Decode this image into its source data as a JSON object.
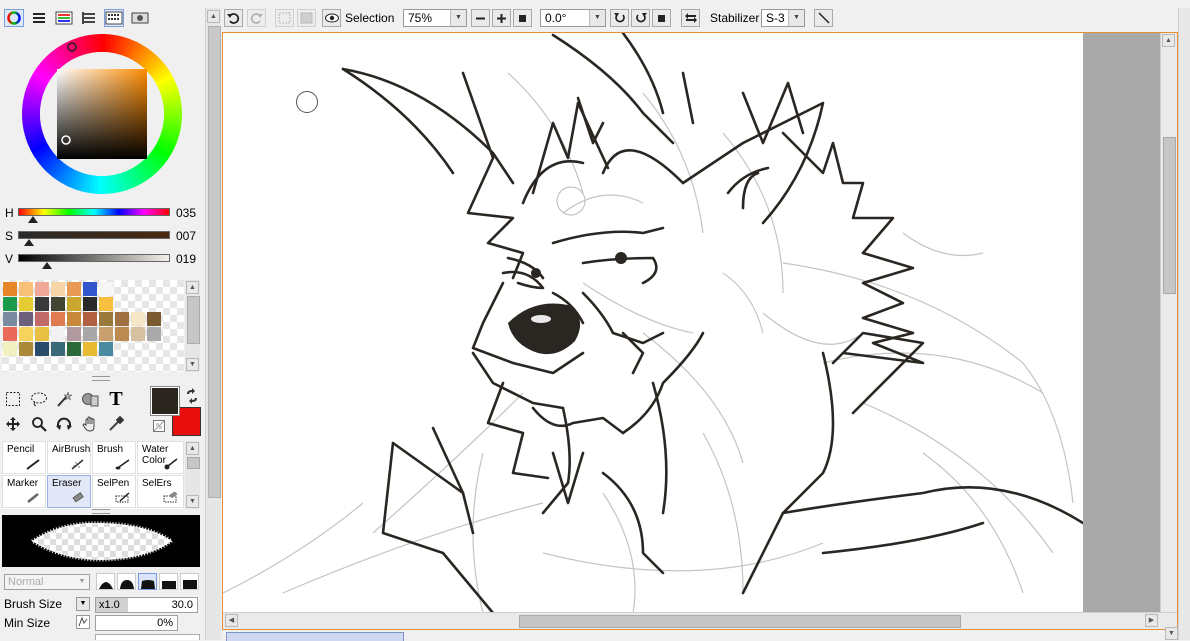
{
  "app": {
    "accent": "#e88c3a"
  },
  "color_panel": {
    "modes": [
      {
        "icon": "color-wheel-icon"
      },
      {
        "icon": "color-slider-icon"
      },
      {
        "icon": "rgb-slider-icon"
      },
      {
        "icon": "hsv-slider-icon"
      },
      {
        "icon": "swatch-grid-icon"
      },
      {
        "icon": "scratchpad-icon"
      }
    ],
    "hsv": {
      "h_label": "H",
      "h_value": "035",
      "h_pos": 0.1,
      "s_label": "S",
      "s_value": "007",
      "s_pos": 0.07,
      "v_label": "V",
      "v_value": "019",
      "v_pos": 0.19
    },
    "foreground_color": "#2b2520",
    "background_color": "#e80e0e",
    "swatches": [
      [
        "#e8862a",
        "#f9c07a",
        "#f0a898",
        "#f6d6a8",
        "#e99b55",
        "#3355cc",
        "#f6f6f6",
        "",
        "",
        "",
        "",
        ""
      ],
      [
        "#1a9a4a",
        "#e6cc33",
        "#3a3a3a",
        "#444433",
        "#caa830",
        "#2a2a2a",
        "#f7c040",
        "",
        "",
        "",
        "",
        ""
      ],
      [
        "#7a8aa0",
        "#6b5f7b",
        "#c06a6a",
        "#e07a50",
        "#c88a3a",
        "#b06040",
        "#9a7a3a",
        "#a07040",
        "#f6e6c8",
        "#7a5a30",
        "",
        ""
      ],
      [
        "#e96a5a",
        "#f6d35a",
        "#e6c040",
        "#f2f2f2",
        "#b09aa0",
        "#a8a8a8",
        "#c8a070",
        "#ba8a50",
        "#d6c0a0",
        "#aaaaaa",
        "",
        ""
      ],
      [
        "#f0f0c0",
        "#aa8a3a",
        "#2a4a6a",
        "#3a6a7a",
        "#2a6a3a",
        "#e6ba33",
        "#4a8aa0",
        "",
        "",
        "",
        "",
        ""
      ]
    ]
  },
  "tools": [
    {
      "icon": "rect-select-icon"
    },
    {
      "icon": "lasso-icon"
    },
    {
      "icon": "magic-wand-icon"
    },
    {
      "icon": "select-pen-icon"
    },
    {
      "icon": "text-tool-icon",
      "glyph": "T"
    },
    {
      "icon": "move-icon"
    },
    {
      "icon": "zoom-icon"
    },
    {
      "icon": "rotate-icon"
    },
    {
      "icon": "hand-icon"
    },
    {
      "icon": "eyedropper-icon"
    }
  ],
  "brushes": [
    {
      "label": "Pencil"
    },
    {
      "label": "AirBrush"
    },
    {
      "label": "Brush"
    },
    {
      "label": "Water Color"
    },
    {
      "label": "Marker"
    },
    {
      "label": "Eraser",
      "selected": true
    },
    {
      "label": "SelPen"
    },
    {
      "label": "SelErs"
    }
  ],
  "brush_settings": {
    "blend_mode": "Normal",
    "brush_size_label": "Brush Size",
    "brush_size_multiplier": "x1.0",
    "brush_size_value": "30.0",
    "min_size_label": "Min Size",
    "min_size_value": "0%"
  },
  "toolbar": {
    "selection_label": "Selection",
    "zoom_value": "75%",
    "rotation_value": "0.0°",
    "stabilizer_label": "Stabilizer",
    "stabilizer_value": "S-3"
  }
}
